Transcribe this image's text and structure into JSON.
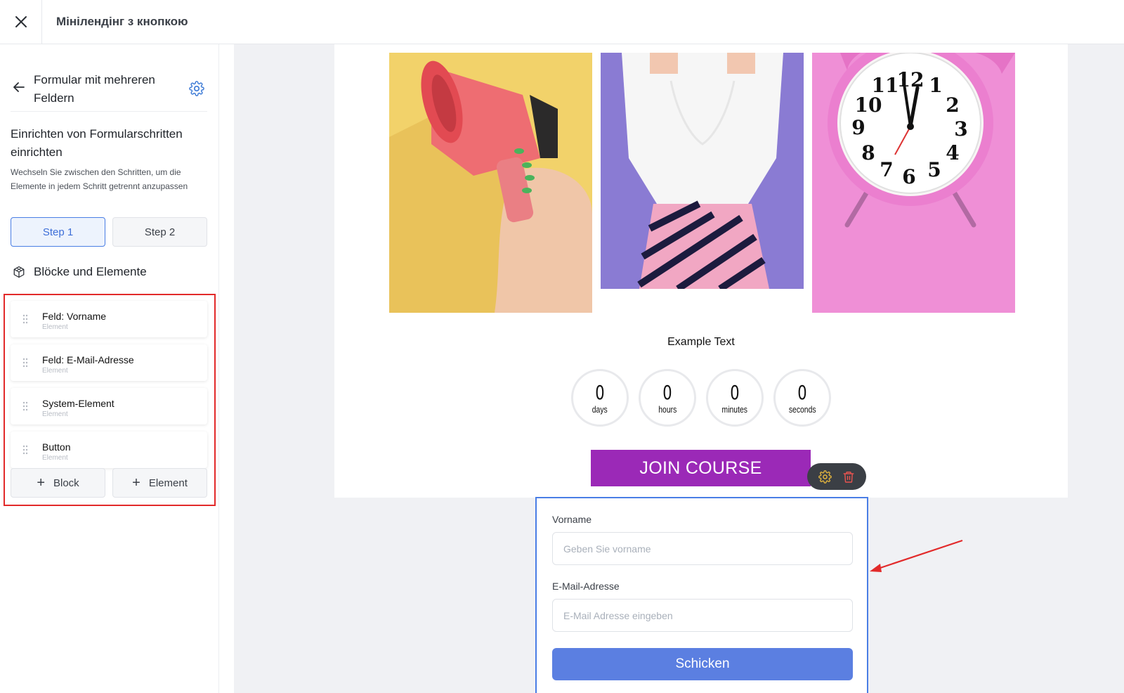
{
  "topbar": {
    "title": "Мінілендінг з кнопкою"
  },
  "sidebar": {
    "title": "Formular mit mehreren Feldern",
    "section_title": "Einrichten von Formularschritten einrichten",
    "description": "Wechseln Sie zwischen den Schritten, um die Elemente in jedem Schritt getrennt anzupassen",
    "steps": [
      {
        "label": "Step 1",
        "active": true
      },
      {
        "label": "Step 2",
        "active": false
      }
    ],
    "blocks_title": "Blöcke und Elemente",
    "elements": [
      {
        "name": "Feld: Vorname",
        "type": "Element"
      },
      {
        "name": "Feld: E-Mail-Adresse",
        "type": "Element"
      },
      {
        "name": "System-Element",
        "type": "Element"
      },
      {
        "name": "Button",
        "type": "Element"
      }
    ],
    "add_block_label": "Block",
    "add_element_label": "Element"
  },
  "page": {
    "example_text": "Example Text",
    "countdown": [
      {
        "value": "0",
        "label": "days"
      },
      {
        "value": "0",
        "label": "hours"
      },
      {
        "value": "0",
        "label": "minutes"
      },
      {
        "value": "0",
        "label": "seconds"
      }
    ],
    "join_button": "JOIN COURSE",
    "clock_numbers": [
      "12",
      "1",
      "2",
      "3",
      "4",
      "5",
      "6",
      "7",
      "8",
      "9",
      "10",
      "11"
    ]
  },
  "form": {
    "fields": [
      {
        "label": "Vorname",
        "placeholder": "Geben Sie vorname"
      },
      {
        "label": "E-Mail-Adresse",
        "placeholder": "E-Mail Adresse eingeben"
      }
    ],
    "submit_label": "Schicken"
  },
  "colors": {
    "accent": "#4a7ee5",
    "join_button": "#9b29b7",
    "submit_button": "#5b7fe1",
    "highlight": "#e22a2a"
  },
  "icons": {
    "close": "close-icon",
    "back": "arrow-left-icon",
    "settings": "gear-icon",
    "blocks": "cube-icon",
    "drag": "drag-handle-icon",
    "add": "plus-icon",
    "delete": "trash-icon"
  }
}
